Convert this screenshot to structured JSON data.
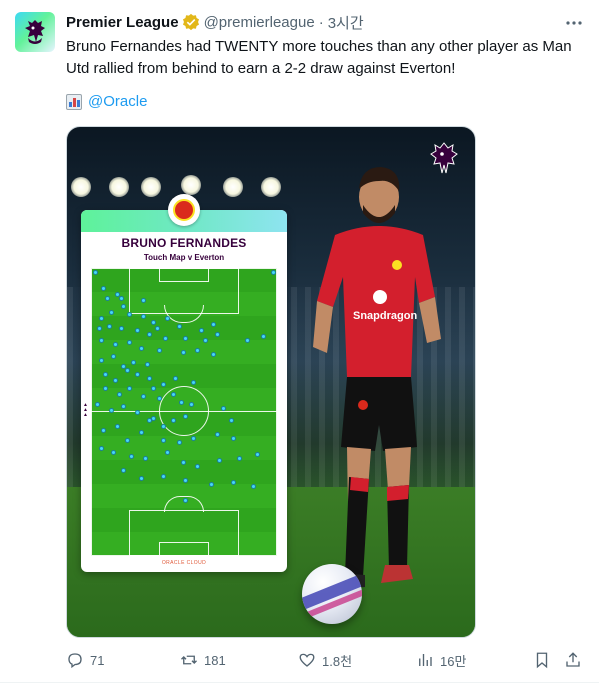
{
  "account": {
    "name": "Premier League",
    "handle": "@premierleague",
    "separator": "·",
    "time": "3시간"
  },
  "tweet": {
    "text": "Bruno Fernandes had TWENTY more touches than any other player as Man Utd rallied from behind to earn a 2-2 draw against Everton!",
    "mention_emoji": "chart-bar-emoji",
    "mention": "@Oracle"
  },
  "media": {
    "card_title": "BRUNO FERNANDES",
    "card_subtitle": "Touch Map v Everton",
    "sponsor": "ORACLE CLOUD",
    "kit_sponsor": "Snapdragon"
  },
  "actions": {
    "replies": "71",
    "reposts": "181",
    "likes": "1.8천",
    "views": "16만"
  },
  "colors": {
    "accent": "#1d9bf0",
    "text_secondary": "#536471",
    "pl_purple": "#37003c",
    "touch_dot": "#46d9f7"
  }
}
